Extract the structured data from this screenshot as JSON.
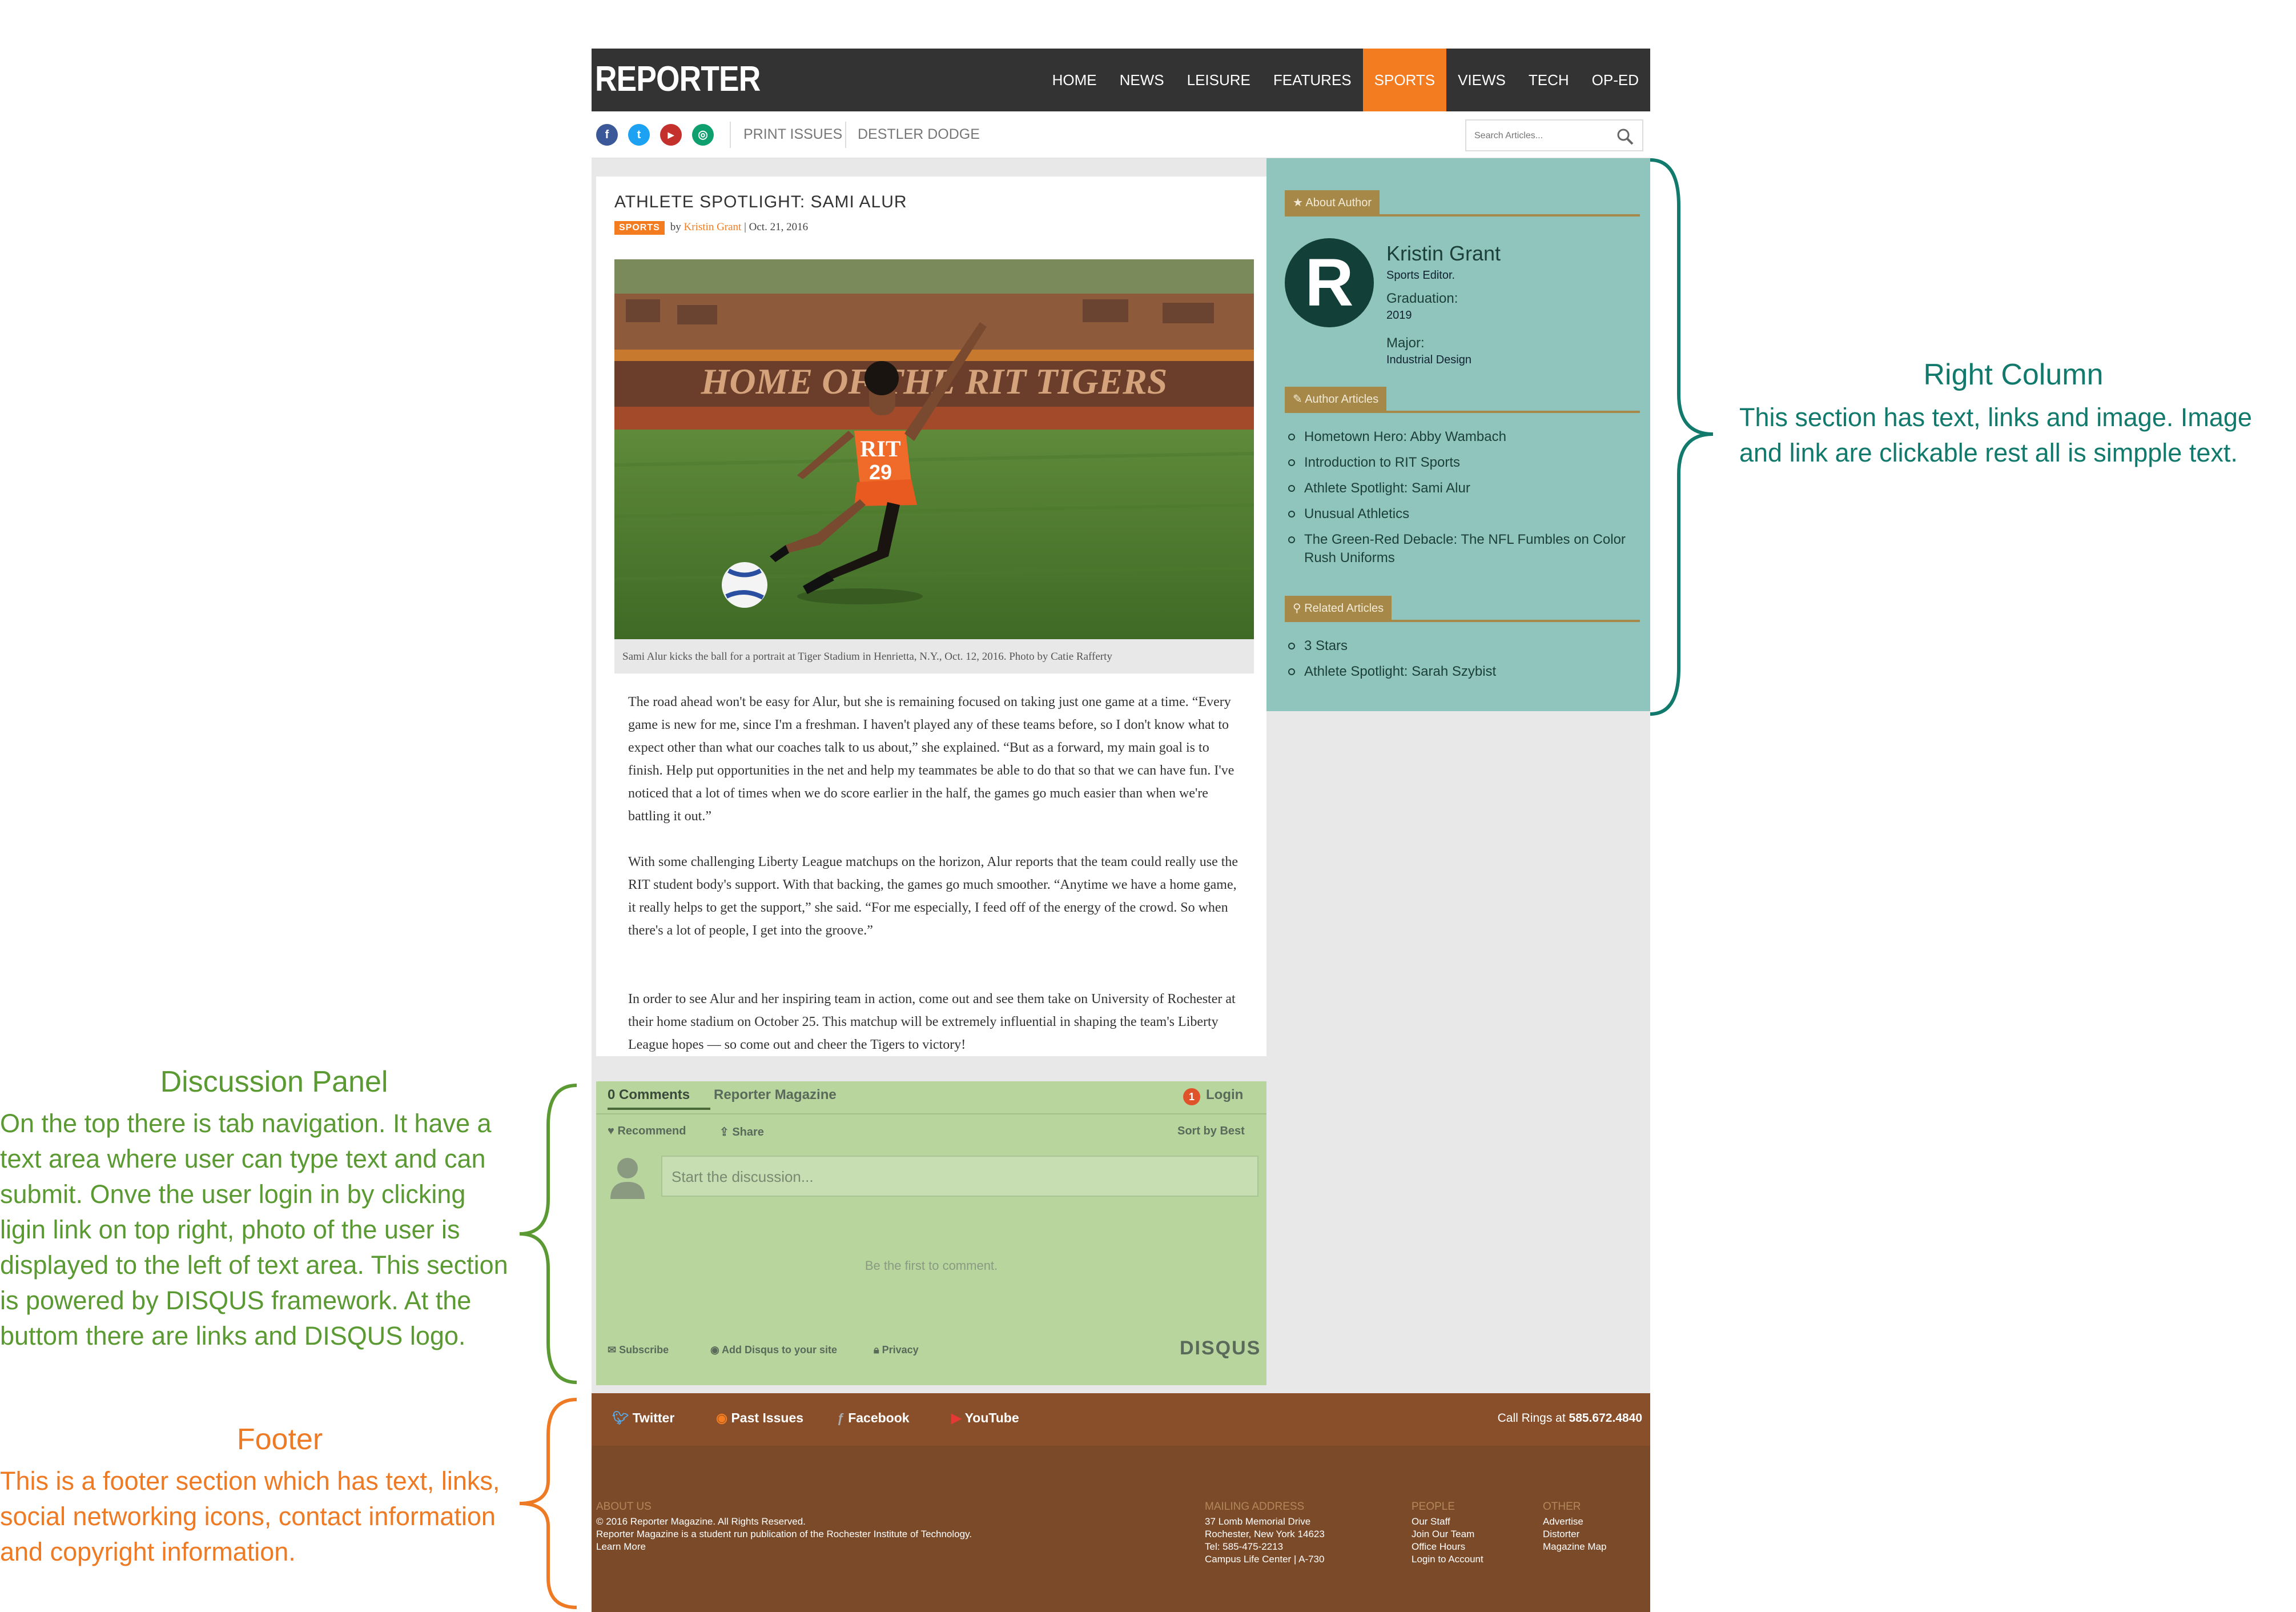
{
  "site": {
    "logo": "REPORTER",
    "nav": [
      {
        "label": "HOME",
        "active": false
      },
      {
        "label": "NEWS",
        "active": false
      },
      {
        "label": "LEISURE",
        "active": false
      },
      {
        "label": "FEATURES",
        "active": false
      },
      {
        "label": "SPORTS",
        "active": true
      },
      {
        "label": "VIEWS",
        "active": false
      },
      {
        "label": "TECH",
        "active": false
      },
      {
        "label": "OP-ED",
        "active": false
      }
    ],
    "social": [
      {
        "icon": "facebook-icon",
        "glyph": "f",
        "color": "#3b5998"
      },
      {
        "icon": "twitter-icon",
        "glyph": "t",
        "color": "#1da1f2"
      },
      {
        "icon": "youtube-icon",
        "glyph": "▶",
        "color": "#c4302b"
      },
      {
        "icon": "instagram-icon",
        "glyph": "◎",
        "color": "#0e9f6e"
      }
    ],
    "sublinks": [
      "PRINT ISSUES",
      "DESTLER DODGE"
    ],
    "search_placeholder": "Search Articles..."
  },
  "article": {
    "title": "ATHLETE SPOTLIGHT: SAMI ALUR",
    "category": "SPORTS",
    "by": "by",
    "author": "Kristin Grant",
    "date": "| Oct. 21, 2016",
    "photo_text": "HOME OF THE RIT TIGERS",
    "jersey_text": "RIT",
    "jersey_number": "29",
    "caption": "Sami Alur kicks the ball for a portrait at Tiger Stadium in Henrietta, N.Y., Oct. 12, 2016. Photo by Catie Rafferty",
    "paragraphs": [
      "The road ahead won't be easy for Alur, but she is remaining focused on taking just one game at a time. “Every game is new for me, since I'm a freshman. I haven't played any of these teams before, so I don't know what to expect other than what our coaches talk to us about,” she explained. “But as a forward, my main goal is to finish. Help put opportunities in the net and help my teammates be able to do that so that we can have fun. I've noticed that a lot of times when we do score earlier in the half, the games go much easier than when we're battling it out.”",
      "With some challenging Liberty League matchups on the horizon, Alur reports that the team could really use the RIT student body's support. With that backing, the games go much smoother. “Anytime we have a home game, it really helps to get the support,” she said. “For me especially, I feed off of the energy of the crowd. So when there's a lot of people, I get into the groove.”",
      "In order to see Alur and her inspiring team in action, come out and see them take on University of Rochester at their home stadium on October 25. This matchup will be extremely influential in shaping the team's Liberty League hopes — so come out and cheer the Tigers to victory!"
    ]
  },
  "sidebar": {
    "about_tab": "About Author",
    "logo_letter": "R",
    "author_name": "Kristin Grant",
    "author_role": "Sports Editor.",
    "grad_label": "Graduation:",
    "grad_value": "2019",
    "major_label": "Major:",
    "major_value": "Industrial Design",
    "articles_tab": "Author Articles",
    "articles": [
      "Hometown Hero: Abby Wambach",
      "Introduction to RIT Sports",
      "Athlete Spotlight: Sami Alur",
      "Unusual Athletics",
      "The Green-Red Debacle: The NFL Fumbles on Color Rush Uniforms"
    ],
    "related_tab": "Related Articles",
    "related": [
      "3 Stars",
      "Athlete Spotlight: Sarah Szybist"
    ]
  },
  "disqus": {
    "tab_comments": "0 Comments",
    "tab_community": "Reporter Magazine",
    "notif_count": "1",
    "login": "Login",
    "recommend": "Recommend",
    "share": "Share",
    "sort": "Sort by Best",
    "placeholder": "Start the discussion...",
    "empty": "Be the first to comment.",
    "subscribe": "Subscribe",
    "add_disqus": "Add Disqus to your site",
    "privacy": "Privacy",
    "brand": "DISQUS"
  },
  "footer": {
    "social": [
      "Twitter",
      "Past Issues",
      "Facebook",
      "YouTube"
    ],
    "call_label": "Call Rings at ",
    "call_number": "585.672.4840",
    "about_head": "ABOUT US",
    "about_lines": [
      "© 2016 Reporter Magazine. All Rights Reserved.",
      "Reporter Magazine is a student run publication of the Rochester Institute of Technology.",
      "Learn More"
    ],
    "mail_head": "MAILING ADDRESS",
    "mail_lines": [
      "37 Lomb Memorial Drive",
      "Rochester, New York 14623",
      "Tel: 585-475-2213",
      "Campus Life Center | A-730"
    ],
    "people_head": "PEOPLE",
    "people_lines": [
      "Our Staff",
      "Join Our Team",
      "Office Hours",
      "Login to Account"
    ],
    "other_head": "OTHER",
    "other_lines": [
      "Advertise",
      "Distorter",
      "Magazine Map"
    ]
  },
  "annotations": {
    "right": {
      "title": "Right Column",
      "lines": [
        "This section has text, links and image. Image",
        "and link are clickable rest all is simpple text."
      ],
      "color": "#127a6c"
    },
    "discussion": {
      "title": "Discussion Panel",
      "lines": [
        "On the top there is tab navigation. It have a",
        "text area where user can type text and can",
        "submit. Onve the user login in by clicking",
        "ligin link on top right, photo of the user is",
        "displayed to the left of text area. This section",
        "is powered by DISQUS framework. At the",
        "buttom there are links and DISQUS logo."
      ],
      "color": "#5b9a33"
    },
    "footer": {
      "title": "Footer",
      "lines": [
        "This is a footer section which has text, links,",
        "social networking icons, contact information",
        "and copyright information."
      ],
      "color": "#ee7a24"
    }
  }
}
